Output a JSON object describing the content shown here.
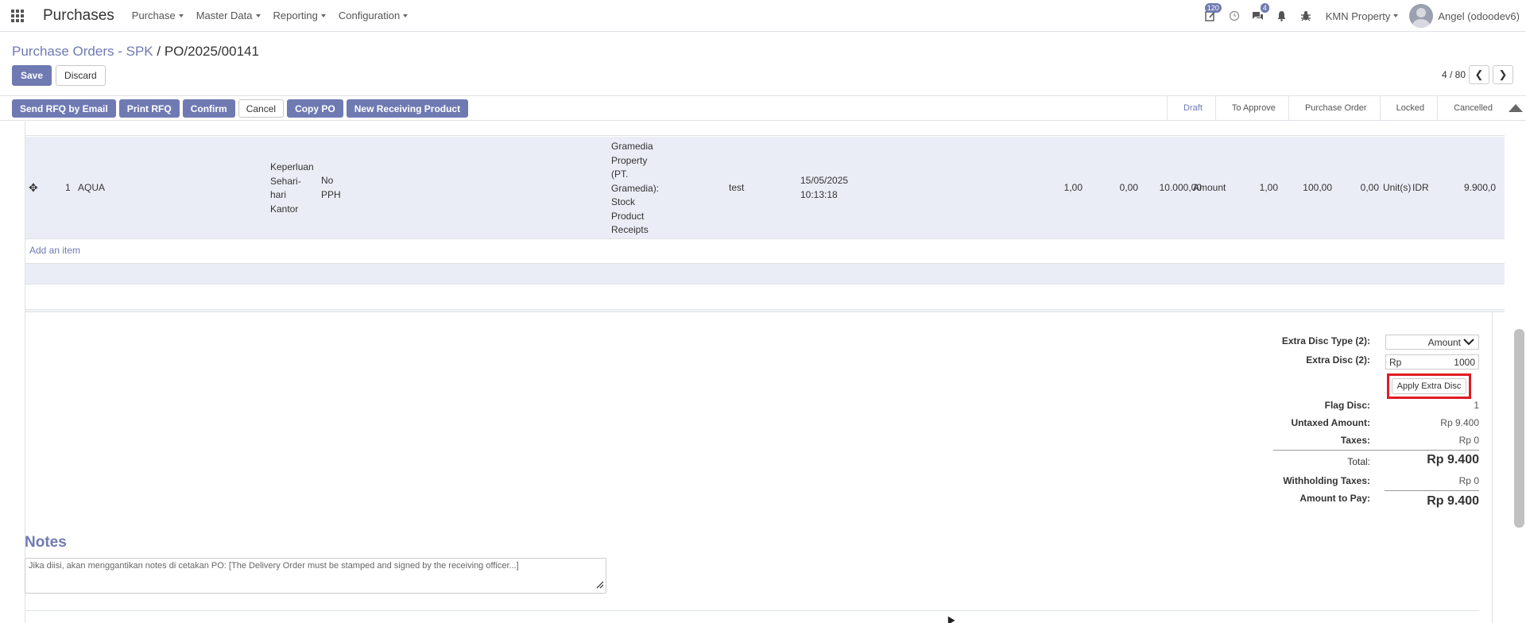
{
  "app": {
    "title": "Purchases",
    "menu": [
      "Purchase",
      "Master Data",
      "Reporting",
      "Configuration"
    ]
  },
  "systray": {
    "activity_badge": "120",
    "messages_badge": "4",
    "company": "KMN Property",
    "user": "Angel (odoodev6)"
  },
  "breadcrumb": {
    "parent": "Purchase Orders - SPK",
    "separator": "/",
    "current": "PO/2025/00141"
  },
  "form_buttons": {
    "save": "Save",
    "discard": "Discard"
  },
  "pager": {
    "value": "4 / 80"
  },
  "actions": [
    "Send RFQ by Email",
    "Print RFQ",
    "Confirm",
    "Cancel",
    "Copy PO",
    "New Receiving Product"
  ],
  "stages": [
    "Draft",
    "To Approve",
    "Purchase Order",
    "Locked",
    "Cancelled"
  ],
  "active_stage": "Draft",
  "order_line": {
    "seq": "1",
    "product": "AQUA",
    "purpose_lines": [
      "Keperluan",
      "Sehari-",
      "hari",
      "Kantor"
    ],
    "tax_lines": [
      "No",
      "PPH"
    ],
    "location_lines": [
      "Gramedia",
      "Property",
      "(PT.",
      "Gramedia):",
      "Stock",
      "Product",
      "Receipts"
    ],
    "description": "test",
    "date_line1": "15/05/2025",
    "date_line2": "10:13:18",
    "qty": "1,00",
    "disc": "0,00",
    "price": "10.000,00",
    "disc_type": "Amount",
    "qty2": "1,00",
    "disc_amount": "100,00",
    "extra": "0,00",
    "uom": "Unit(s)",
    "currency": "IDR",
    "subtotal": "9.900,0"
  },
  "add_item": "Add an item",
  "totals": {
    "extra_disc_type_label": "Extra Disc Type (2):",
    "extra_disc_type_value": "Amount",
    "extra_disc_label": "Extra Disc (2):",
    "extra_disc_currency": "Rp",
    "extra_disc_value": "1000",
    "apply_button": "Apply Extra Disc",
    "flag_disc_label": "Flag Disc:",
    "flag_disc_value": "1",
    "untaxed_label": "Untaxed Amount:",
    "untaxed_value": "Rp 9.400",
    "taxes_label": "Taxes:",
    "taxes_value": "Rp 0",
    "total_label": "Total:",
    "total_value": "Rp 9.400",
    "withholding_label": "Withholding Taxes:",
    "withholding_value": "Rp 0",
    "amount_to_pay_label": "Amount to Pay:",
    "amount_to_pay_value": "Rp 9.400"
  },
  "notes": {
    "title": "Notes",
    "placeholder": "Jika diisi, akan menggantikan notes di cetakan PO: [The Delivery Order must be stamped and signed by the receiving officer...]"
  },
  "colors": {
    "accent": "#6f7ab3",
    "row_highlight": "#ebedf6",
    "highlight_box": "#e01b24"
  }
}
